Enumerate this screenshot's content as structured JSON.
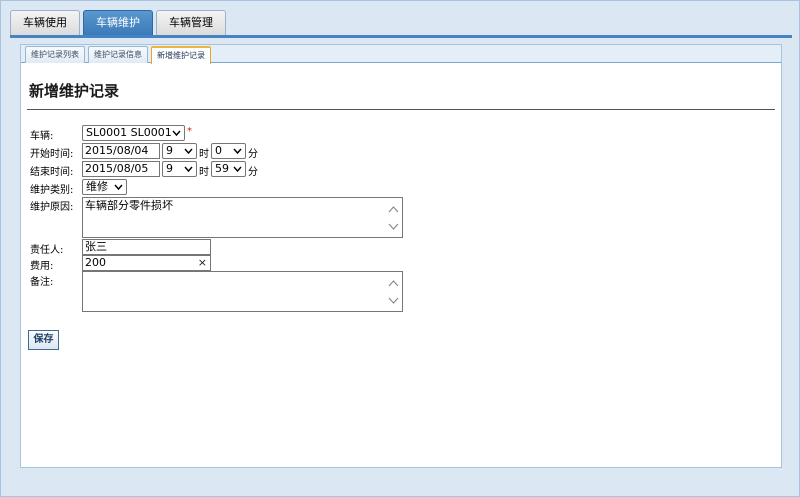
{
  "top_tabs": [
    {
      "label": "车辆使用",
      "active": false
    },
    {
      "label": "车辆维护",
      "active": true
    },
    {
      "label": "车辆管理",
      "active": false
    }
  ],
  "sub_tabs": [
    {
      "label": "维护记录列表",
      "active": false
    },
    {
      "label": "维护记录信息",
      "active": false
    },
    {
      "label": "新增维护记录",
      "active": true
    }
  ],
  "form": {
    "title": "新增维护记录",
    "vehicle_label": "车辆:",
    "vehicle_value": "SL0001 SL0001",
    "required_mark": "*",
    "start_label": "开始时间:",
    "start_date": "2015/08/04",
    "start_hour": "9",
    "start_minute": "0",
    "end_label": "结束时间:",
    "end_date": "2015/08/05",
    "end_hour": "9",
    "end_minute": "59",
    "hour_unit": "时",
    "minute_unit": "分",
    "type_label": "维护类别:",
    "type_value": "维修",
    "reason_label": "维护原因:",
    "reason_value": "车辆部分零件损坏",
    "person_label": "责任人:",
    "person_value": "张三",
    "cost_label": "费用:",
    "cost_value": "200",
    "clear_glyph": "×",
    "notes_label": "备注:",
    "notes_value": "",
    "save_label": "保存"
  },
  "colors": {
    "active_tab": "#4684c1",
    "page_bg": "#dbe8f4",
    "required": "#d32020"
  }
}
